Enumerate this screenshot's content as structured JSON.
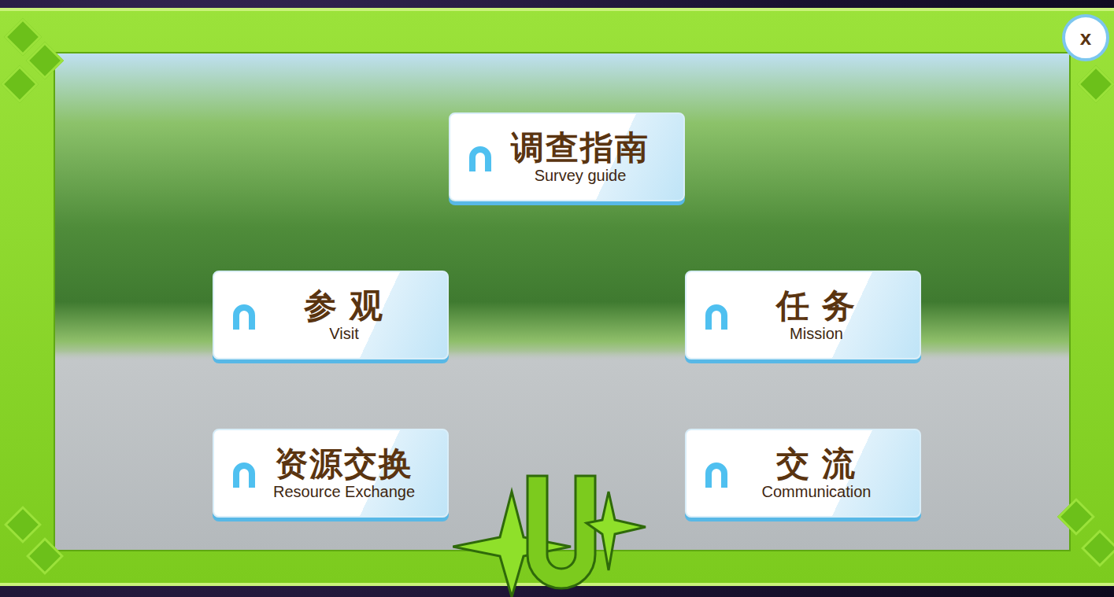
{
  "menu": {
    "close": "x",
    "buttons": [
      {
        "label": "调查指南",
        "sublabel": "Survey guide",
        "featured": true
      },
      {
        "label": "参 观",
        "sublabel": "Visit",
        "featured": false
      },
      {
        "label": "任 务",
        "sublabel": "Mission",
        "featured": false
      },
      {
        "label": "资源交换",
        "sublabel": "Resource Exchange",
        "featured": false
      },
      {
        "label": "交 流",
        "sublabel": "Communication",
        "featured": false
      }
    ]
  }
}
